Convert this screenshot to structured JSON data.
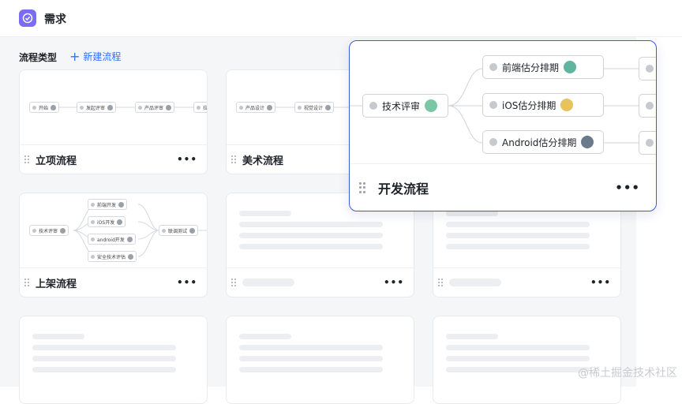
{
  "header": {
    "title": "需求"
  },
  "toolbar": {
    "section_title": "流程类型",
    "new_label": "新建流程"
  },
  "cards": [
    {
      "name": "立项流程",
      "more": "•••",
      "nodes": [
        "开始",
        "发起评审",
        "产品评审",
        "拉"
      ]
    },
    {
      "name": "美术流程",
      "more": "•••",
      "nodes": [
        "产品设计",
        "视觉设计"
      ]
    },
    {
      "name": "上架流程",
      "more": "•••",
      "nodes": [
        "技术评审",
        "前端开发",
        "iOS开发",
        "android开发",
        "安全技术评估",
        "联调测试"
      ]
    },
    {
      "more": "•••"
    },
    {
      "more": "•••"
    }
  ],
  "popup": {
    "name": "开发流程",
    "more": "•••",
    "nodes": [
      "技术评审",
      "前端估分排期",
      "iOS估分排期",
      "Android估分排期"
    ]
  },
  "watermark": "@稀土掘金技术社区"
}
